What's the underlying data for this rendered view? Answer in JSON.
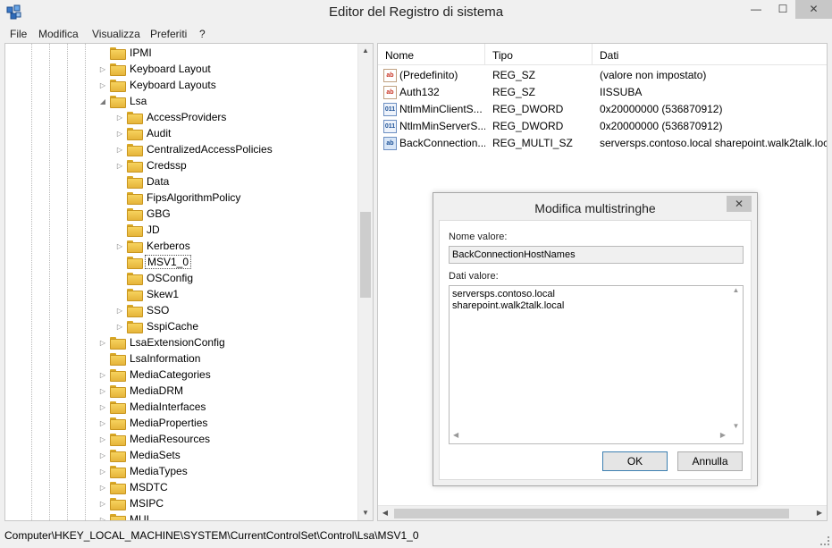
{
  "window": {
    "title": "Editor del Registro di sistema",
    "controls": {
      "minimize": "—",
      "maximize": "☐",
      "close": "✕"
    }
  },
  "menu": [
    "File",
    "Modifica",
    "Visualizza",
    "Preferiti",
    "?"
  ],
  "tree": {
    "items": [
      {
        "label": "IPMI",
        "level": 0,
        "expander": ""
      },
      {
        "label": "Keyboard Layout",
        "level": 0,
        "expander": "collapsed"
      },
      {
        "label": "Keyboard Layouts",
        "level": 0,
        "expander": "collapsed"
      },
      {
        "label": "Lsa",
        "level": 0,
        "expander": "expanded"
      },
      {
        "label": "AccessProviders",
        "level": 1,
        "expander": "collapsed"
      },
      {
        "label": "Audit",
        "level": 1,
        "expander": "collapsed"
      },
      {
        "label": "CentralizedAccessPolicies",
        "level": 1,
        "expander": "collapsed"
      },
      {
        "label": "Credssp",
        "level": 1,
        "expander": "collapsed"
      },
      {
        "label": "Data",
        "level": 1,
        "expander": ""
      },
      {
        "label": "FipsAlgorithmPolicy",
        "level": 1,
        "expander": ""
      },
      {
        "label": "GBG",
        "level": 1,
        "expander": ""
      },
      {
        "label": "JD",
        "level": 1,
        "expander": ""
      },
      {
        "label": "Kerberos",
        "level": 1,
        "expander": "collapsed"
      },
      {
        "label": "MSV1_0",
        "level": 1,
        "expander": "",
        "selected": true
      },
      {
        "label": "OSConfig",
        "level": 1,
        "expander": ""
      },
      {
        "label": "Skew1",
        "level": 1,
        "expander": ""
      },
      {
        "label": "SSO",
        "level": 1,
        "expander": "collapsed"
      },
      {
        "label": "SspiCache",
        "level": 1,
        "expander": "collapsed"
      },
      {
        "label": "LsaExtensionConfig",
        "level": 0,
        "expander": "collapsed"
      },
      {
        "label": "LsaInformation",
        "level": 0,
        "expander": ""
      },
      {
        "label": "MediaCategories",
        "level": 0,
        "expander": "collapsed"
      },
      {
        "label": "MediaDRM",
        "level": 0,
        "expander": "collapsed"
      },
      {
        "label": "MediaInterfaces",
        "level": 0,
        "expander": "collapsed"
      },
      {
        "label": "MediaProperties",
        "level": 0,
        "expander": "collapsed"
      },
      {
        "label": "MediaResources",
        "level": 0,
        "expander": "collapsed"
      },
      {
        "label": "MediaSets",
        "level": 0,
        "expander": "collapsed"
      },
      {
        "label": "MediaTypes",
        "level": 0,
        "expander": "collapsed"
      },
      {
        "label": "MSDTC",
        "level": 0,
        "expander": "collapsed"
      },
      {
        "label": "MSIPC",
        "level": 0,
        "expander": "collapsed"
      },
      {
        "label": "MUI",
        "level": 0,
        "expander": "collapsed"
      }
    ]
  },
  "values": {
    "columns": {
      "name": "Nome",
      "type": "Tipo",
      "data": "Dati"
    },
    "rows": [
      {
        "icon": "ab",
        "name": "(Predefinito)",
        "type": "REG_SZ",
        "data": "(valore non impostato)"
      },
      {
        "icon": "ab",
        "name": "Auth132",
        "type": "REG_SZ",
        "data": "IISSUBA"
      },
      {
        "icon": "011",
        "name": "NtlmMinClientS...",
        "type": "REG_DWORD",
        "data": "0x20000000 (536870912)"
      },
      {
        "icon": "011",
        "name": "NtlmMinServerS...",
        "type": "REG_DWORD",
        "data": "0x20000000 (536870912)"
      },
      {
        "icon": "ab",
        "name": "BackConnection...",
        "type": "REG_MULTI_SZ",
        "data": "serversps.contoso.local sharepoint.walk2talk.loc"
      }
    ]
  },
  "status": {
    "path": "Computer\\HKEY_LOCAL_MACHINE\\SYSTEM\\CurrentControlSet\\Control\\Lsa\\MSV1_0"
  },
  "dialog": {
    "title": "Modifica multistringhe",
    "close": "✕",
    "name_label": "Nome valore:",
    "name_value": "BackConnectionHostNames",
    "data_label": "Dati valore:",
    "data_lines": [
      "serversps.contoso.local",
      "sharepoint.walk2talk.local"
    ],
    "ok": "OK",
    "cancel": "Annulla"
  }
}
